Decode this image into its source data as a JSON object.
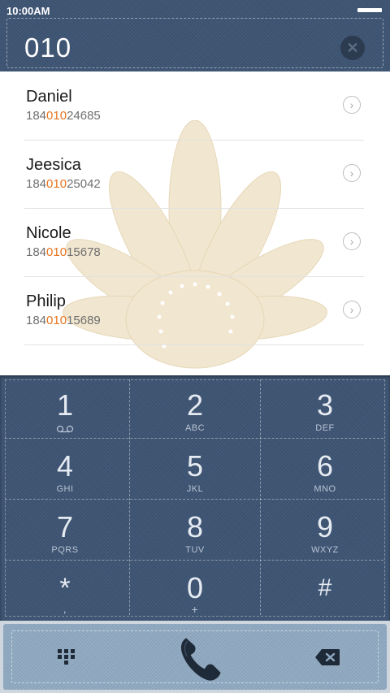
{
  "status_bar": {
    "time": "10:00AM"
  },
  "header": {
    "dialed_number": "010"
  },
  "contacts": [
    {
      "name": "Daniel",
      "number_pre": "184",
      "number_match": "010",
      "number_post": "24685"
    },
    {
      "name": "Jeesica",
      "number_pre": "184",
      "number_match": "010",
      "number_post": "25042"
    },
    {
      "name": "Nicole",
      "number_pre": "184",
      "number_match": "010",
      "number_post": "15678"
    },
    {
      "name": "Philip",
      "number_pre": "184",
      "number_match": "010",
      "number_post": "15689"
    }
  ],
  "keypad": {
    "keys": [
      {
        "digit": "1",
        "sub": "voicemail-icon"
      },
      {
        "digit": "2",
        "sub": "ABC"
      },
      {
        "digit": "3",
        "sub": "DEF"
      },
      {
        "digit": "4",
        "sub": "GHI"
      },
      {
        "digit": "5",
        "sub": "JKL"
      },
      {
        "digit": "6",
        "sub": "MNO"
      },
      {
        "digit": "7",
        "sub": "PQRS"
      },
      {
        "digit": "8",
        "sub": "TUV"
      },
      {
        "digit": "9",
        "sub": "WXYZ"
      },
      {
        "digit": "*",
        "sub": ","
      },
      {
        "digit": "0",
        "sub": "+"
      },
      {
        "digit": "#",
        "sub": ""
      }
    ]
  },
  "colors": {
    "denim": "#3e5574",
    "highlight": "#e8741e",
    "action_bar": "#8fa9c1",
    "flower": "#f1e6cf"
  },
  "icons": {
    "clear": "close-icon",
    "detail": "chevron-right-icon",
    "dialpad": "dialpad-grid-icon",
    "call": "phone-handset-icon",
    "backspace": "backspace-icon"
  }
}
